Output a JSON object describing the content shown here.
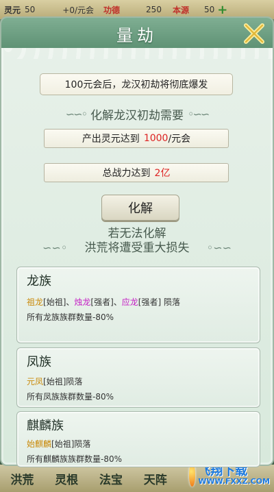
{
  "topbar": {
    "res1_label": "灵元",
    "res1_value": "50",
    "res1_rate": "+0/元会",
    "res2_label": "功德",
    "res2_value": "250",
    "res3_label": "本源",
    "res3_value": "50",
    "plus": "+"
  },
  "panel": {
    "title": "量劫",
    "headline": "100元会后，龙汉初劫将彻底爆发",
    "requirement_header": "化解龙汉初劫需要",
    "req1_prefix": "产出灵元达到",
    "req1_value": "1000",
    "req1_suffix": "/元会",
    "req2_prefix": "总战力达到",
    "req2_value": "2亿",
    "resolve_button": "化解",
    "warning_line1": "若无法化解",
    "warning_line2": "洪荒将遭受重大损失"
  },
  "cards": [
    {
      "title": "龙族",
      "n1": "祖龙",
      "r1": "[始祖]、",
      "n2": "烛龙",
      "r2": "[强者]、",
      "n3": "应龙",
      "r3": "[强者] 陨落",
      "loss": "所有龙族族群数量-80%"
    },
    {
      "title": "凤族",
      "n1": "元凤",
      "r1": "[始祖]陨落",
      "loss": "所有凤族族群数量-80%"
    },
    {
      "title": "麒麟族",
      "n1": "始麒麟",
      "r1": "[始祖]陨落",
      "loss": "所有麒麟族族群数量-80%"
    }
  ],
  "bottom_nav": [
    "洪荒",
    "灵根",
    "法宝",
    "天阵"
  ],
  "watermark": {
    "line1": "飞翔下载",
    "line2": "WWW.FXXZ.COM"
  },
  "colors": {
    "header": "#6fa083",
    "highlight_red": "#dd2222",
    "ancestor_gold": "#c98a0a",
    "strong_pink": "#c41ec4"
  }
}
